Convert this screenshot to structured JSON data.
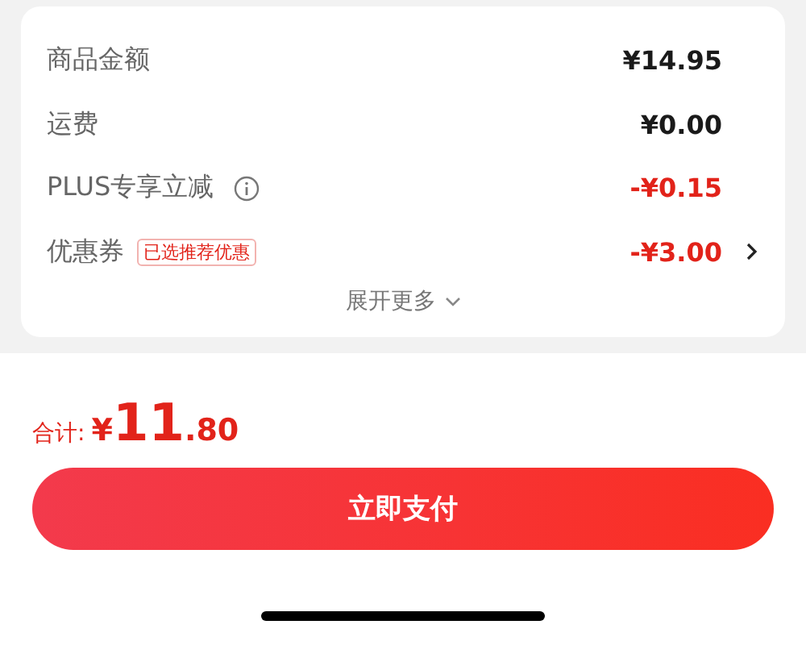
{
  "summary": {
    "rows": [
      {
        "kind": "plain",
        "label": "商品金额",
        "value": "¥14.95",
        "discount": false
      },
      {
        "kind": "plain",
        "label": "运费",
        "value": "¥0.00",
        "discount": false
      },
      {
        "kind": "info",
        "label": "PLUS专享立减",
        "value": "-¥0.15",
        "discount": true
      },
      {
        "kind": "coupon",
        "label": "优惠券",
        "badge": "已选推荐优惠",
        "value": "-¥3.00",
        "discount": true
      }
    ],
    "expand": "展开更多"
  },
  "total": {
    "label": "合计:",
    "currency": "¥",
    "integer": "11",
    "decimal": ".80"
  },
  "pay_button": "立即支付"
}
